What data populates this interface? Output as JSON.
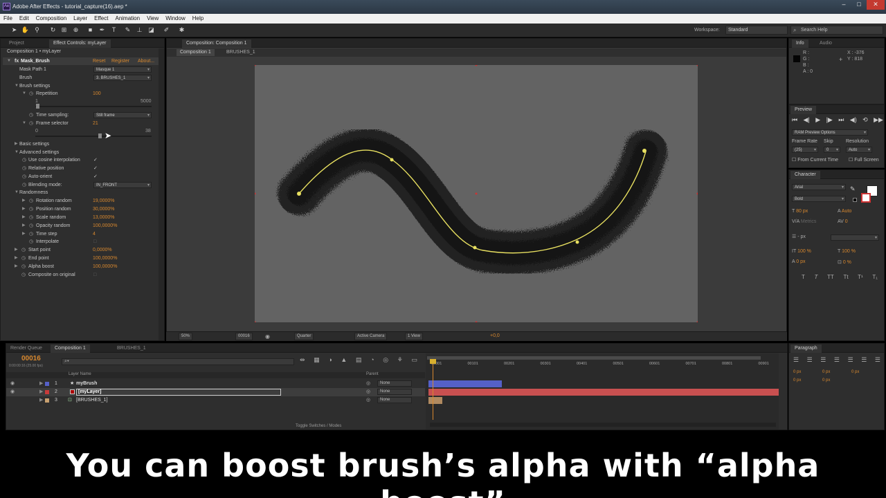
{
  "window": {
    "title": "Adobe After Effects - tutorial_capture(16).aep *",
    "app_icon": "Ae",
    "controls": [
      "–",
      "□",
      "✕"
    ]
  },
  "menu": [
    "File",
    "Edit",
    "Composition",
    "Layer",
    "Effect",
    "Animation",
    "View",
    "Window",
    "Help"
  ],
  "toolbar": {
    "workspace_label": "Workspace:",
    "workspace_value": "Standard",
    "search_placeholder": "Search Help"
  },
  "left_panel": {
    "tabs": [
      "Project",
      "Effect Controls: myLayer"
    ],
    "subtitle": "Composition 1 • myLayer",
    "effect_name": "Mask_Brush",
    "effect_links": [
      "Reset",
      "Register",
      "About..."
    ],
    "mask_path_label": "Mask Path 1",
    "mask_path_value": "Masque 1",
    "brush_label": "Brush",
    "brush_value": "3. BRUSHES_1",
    "brush_settings": "Brush settings",
    "repetition_label": "Repetition",
    "repetition_value": "100",
    "repetition_min": "1",
    "repetition_max": "5000",
    "time_sampling_label": "Time sampling:",
    "time_sampling_value": "Still frame",
    "frame_selector_label": "Frame selector",
    "frame_selector_value": "21",
    "frame_min": "0",
    "frame_max": "38",
    "basic_settings": "Basic settings",
    "advanced_settings": "Advanced settings",
    "use_cosine": "Use cosine interpolation",
    "relative_position": "Relative position",
    "auto_orient": "Auto-orient",
    "blending_mode_label": "Blending mode:",
    "blending_mode_value": "IN_FRONT",
    "randomness": "Randomness",
    "rotation_random": "Rotation random",
    "rotation_random_value": "19,0000%",
    "position_random": "Position random",
    "position_random_value": "30,0000%",
    "scale_random": "Scale random",
    "scale_random_value": "13,0000%",
    "opacity_random": "Opacity random",
    "opacity_random_value": "100,0000%",
    "time_step": "Time step",
    "time_step_value": "4",
    "interpolate": "Interpolate",
    "start_point": "Start point",
    "start_point_value": "0,0000%",
    "end_point": "End point",
    "end_point_value": "100,0000%",
    "alpha_boost": "Alpha boost",
    "alpha_boost_value": "100,0000%",
    "composite_on_original": "Composite on original",
    "check": "✓"
  },
  "comp_panel": {
    "tab": "Composition: Composition 1",
    "breadcrumbs": [
      "Composition 1",
      "BRUSHES_1"
    ],
    "zoom": "50%",
    "timecode": "00016",
    "resolution": "Quarter",
    "camera": "Active Camera",
    "view": "1 View",
    "exposure": "+0,0"
  },
  "info_panel": {
    "tabs": [
      "Info",
      "Audio"
    ],
    "r": "R :",
    "g": "G :",
    "b": "B :",
    "a": "A : 0",
    "x": "X : -376",
    "y": "Y : 818"
  },
  "preview_panel": {
    "title": "Preview",
    "ram_preview": "RAM Preview Options",
    "frame_rate_label": "Frame Rate",
    "skip_label": "Skip",
    "resolution_label": "Resolution",
    "frame_rate_value": "(25)",
    "skip_value": "0",
    "resolution_value": "Auto",
    "from_current": "From Current Time",
    "full_screen": "Full Screen"
  },
  "character_panel": {
    "title": "Character",
    "font": "Arial",
    "style": "Bold",
    "size": "80 px",
    "leading": "Auto",
    "kerning": "Metrics",
    "tracking": "0",
    "stroke_unit": "- px",
    "vscale": "100 %",
    "hscale": "100 %",
    "baseline": "0 px",
    "tsume": "0 %",
    "styles": [
      "T",
      "T",
      "TT",
      "Tt",
      "T¹",
      "T₁"
    ]
  },
  "paragraph_panel": {
    "title": "Paragraph",
    "indents": [
      "0 px",
      "0 px",
      "0 px",
      "0 px",
      "0 px"
    ]
  },
  "timeline": {
    "tabs": [
      "Render Queue",
      "Composition 1",
      "BRUSHES_1"
    ],
    "timecode": "00016",
    "timecode_sub": "0:00:00:16 (25.00 fps)",
    "column_layer_name": "Layer Name",
    "column_parent": "Parent",
    "ruler": [
      "00001",
      "00101",
      "00201",
      "00301",
      "00401",
      "00501",
      "00601",
      "00701",
      "00801",
      "00901"
    ],
    "layers": [
      {
        "num": "1",
        "name": "myBrush",
        "parent": "None",
        "color": "#5560c8"
      },
      {
        "num": "2",
        "name": "[myLayer]",
        "parent": "None",
        "color": "#c83a3a"
      },
      {
        "num": "3",
        "name": "[BRUSHES_1]",
        "parent": "None",
        "color": "#c8a070"
      }
    ],
    "toggle_label": "Toggle Switches / Modes"
  },
  "subtitle": "You can boost brush’s alpha with “alpha boost”",
  "colors": {
    "accent": "#d8882e",
    "path": "#e8e060",
    "panel_bg": "#2e2e2e",
    "canvas": "#636363"
  }
}
